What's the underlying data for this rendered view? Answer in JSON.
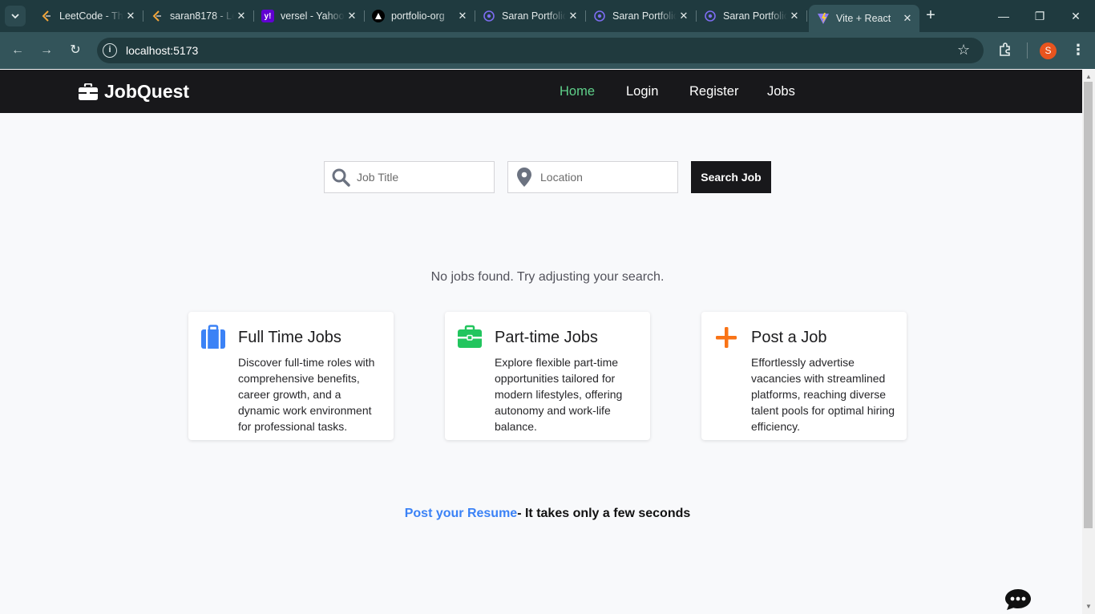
{
  "browser": {
    "tabs": [
      {
        "title": "LeetCode - The",
        "favicon": "leetcode-icon",
        "active": false
      },
      {
        "title": "saran8178 - LeetCode",
        "favicon": "leetcode-icon",
        "active": false
      },
      {
        "title": "versel - Yahoo",
        "favicon": "yahoo-icon",
        "active": false
      },
      {
        "title": "portfolio-org",
        "favicon": "vercel-icon",
        "active": false
      },
      {
        "title": "Saran Portfolio",
        "favicon": "portfolio-icon",
        "active": false
      },
      {
        "title": "Saran Portfolio",
        "favicon": "portfolio-icon",
        "active": false
      },
      {
        "title": "Saran Portfolio",
        "favicon": "portfolio-icon",
        "active": false
      },
      {
        "title": "Vite + React",
        "favicon": "vite-icon",
        "active": true
      }
    ],
    "url": "localhost:5173",
    "profile_initial": "S"
  },
  "site": {
    "brand": "JobQuest",
    "nav": [
      {
        "label": "Home",
        "active": true
      },
      {
        "label": "Login",
        "active": false
      },
      {
        "label": "Register",
        "active": false
      },
      {
        "label": "Jobs",
        "active": false
      }
    ]
  },
  "search": {
    "title_placeholder": "Job Title",
    "location_placeholder": "Location",
    "button_label": "Search Job"
  },
  "results": {
    "empty_message": "No jobs found. Try adjusting your search."
  },
  "cards": [
    {
      "title": "Full Time Jobs",
      "text": "Discover full-time roles with comprehensive benefits, career growth, and a dynamic work environment for professional tasks.",
      "icon": "suitcase-icon",
      "color": "#3b82f6"
    },
    {
      "title": "Part-time Jobs",
      "text": "Explore flexible part-time opportunities tailored for modern lifestyles, offering autonomy and work-life balance.",
      "icon": "briefcase-icon",
      "color": "#22c55e"
    },
    {
      "title": "Post a Job",
      "text": "Effortlessly advertise vacancies with streamlined platforms, reaching diverse talent pools for optimal hiring efficiency.",
      "icon": "plus-icon",
      "color": "#f97316"
    }
  ],
  "resume": {
    "link_text": "Post your Resume",
    "rest_text": "- It takes only a few seconds"
  },
  "colors": {
    "navbar_bg": "#18181b",
    "nav_active": "#5fd08a",
    "link_blue": "#3b82f6"
  }
}
